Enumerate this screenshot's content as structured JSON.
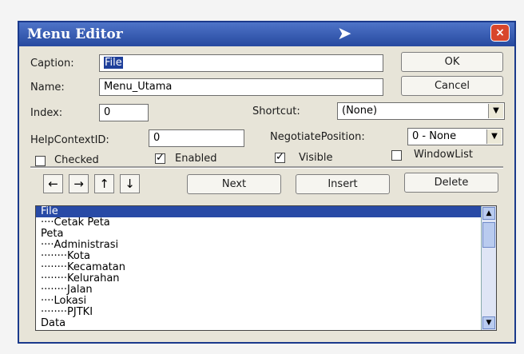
{
  "window": {
    "title": "Menu Editor",
    "close_icon": "×"
  },
  "form": {
    "caption_label": "Caption:",
    "caption_value": "File",
    "name_label": "Name:",
    "name_value": "Menu_Utama",
    "index_label": "Index:",
    "index_value": "0",
    "shortcut_label": "Shortcut:",
    "shortcut_value": "(None)",
    "helpcontext_label": "HelpContextID:",
    "helpcontext_value": "0",
    "negotiate_label": "NegotiatePosition:",
    "negotiate_value": "0 - None",
    "checked_label": "Checked",
    "checked_state": false,
    "enabled_label": "Enabled",
    "enabled_state": true,
    "visible_label": "Visible",
    "visible_state": true,
    "windowlist_label": "WindowList",
    "windowlist_state": false
  },
  "buttons": {
    "ok": "OK",
    "cancel": "Cancel",
    "next": "Next",
    "insert": "Insert",
    "delete": "Delete"
  },
  "arrows": [
    "←",
    "→",
    "↑",
    "↓"
  ],
  "menu_list": [
    "File",
    "····Cetak Peta",
    "Peta",
    "····Administrasi",
    "········Kota",
    "········Kecamatan",
    "········Kelurahan",
    "········Jalan",
    "····Lokasi",
    "········PJTKI",
    "Data"
  ],
  "selected_index": 0
}
